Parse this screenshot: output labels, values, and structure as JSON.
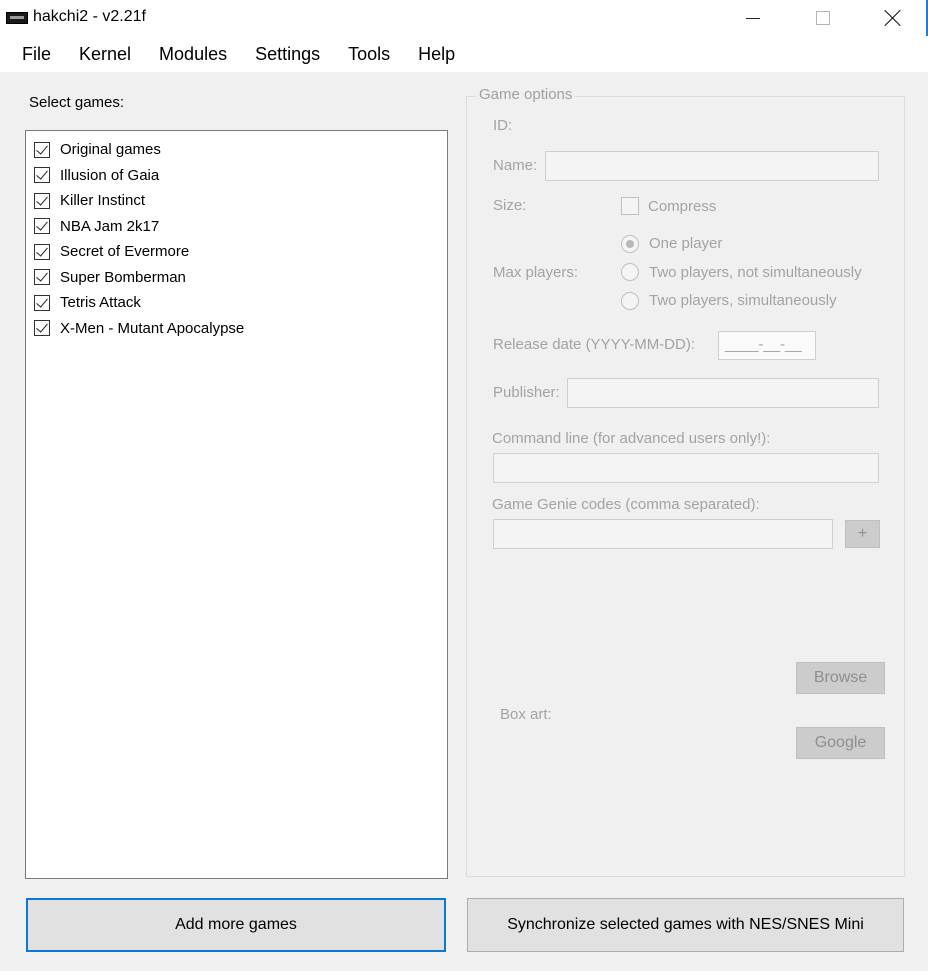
{
  "window": {
    "title": "hakchi2 - v2.21f"
  },
  "menu": [
    "File",
    "Kernel",
    "Modules",
    "Settings",
    "Tools",
    "Help"
  ],
  "left": {
    "select_label": "Select games:",
    "games": [
      {
        "name": "Original games",
        "checked": true
      },
      {
        "name": "Illusion of Gaia",
        "checked": true
      },
      {
        "name": "Killer Instinct",
        "checked": true
      },
      {
        "name": "NBA Jam 2k17",
        "checked": true
      },
      {
        "name": "Secret of Evermore",
        "checked": true
      },
      {
        "name": "Super Bomberman",
        "checked": true
      },
      {
        "name": "Tetris Attack",
        "checked": true
      },
      {
        "name": "X-Men - Mutant Apocalypse",
        "checked": true
      }
    ]
  },
  "options": {
    "legend": "Game options",
    "id_label": "ID:",
    "name_label": "Name:",
    "name_value": "",
    "size_label": "Size:",
    "compress_label": "Compress",
    "max_players_label": "Max players:",
    "players": [
      "One player",
      "Two players, not simultaneously",
      "Two players, simultaneously"
    ],
    "players_selected": 0,
    "release_label": "Release date (YYYY-MM-DD):",
    "release_value": "____-__-__",
    "publisher_label": "Publisher:",
    "publisher_value": "",
    "command_label": "Command line (for advanced users only!):",
    "command_value": "",
    "genie_label": "Game Genie codes (comma separated):",
    "genie_value": "",
    "genie_add": "+",
    "boxart_label": "Box art:",
    "browse": "Browse",
    "google": "Google"
  },
  "buttons": {
    "add": "Add more games",
    "sync": "Synchronize selected games with NES/SNES Mini"
  }
}
